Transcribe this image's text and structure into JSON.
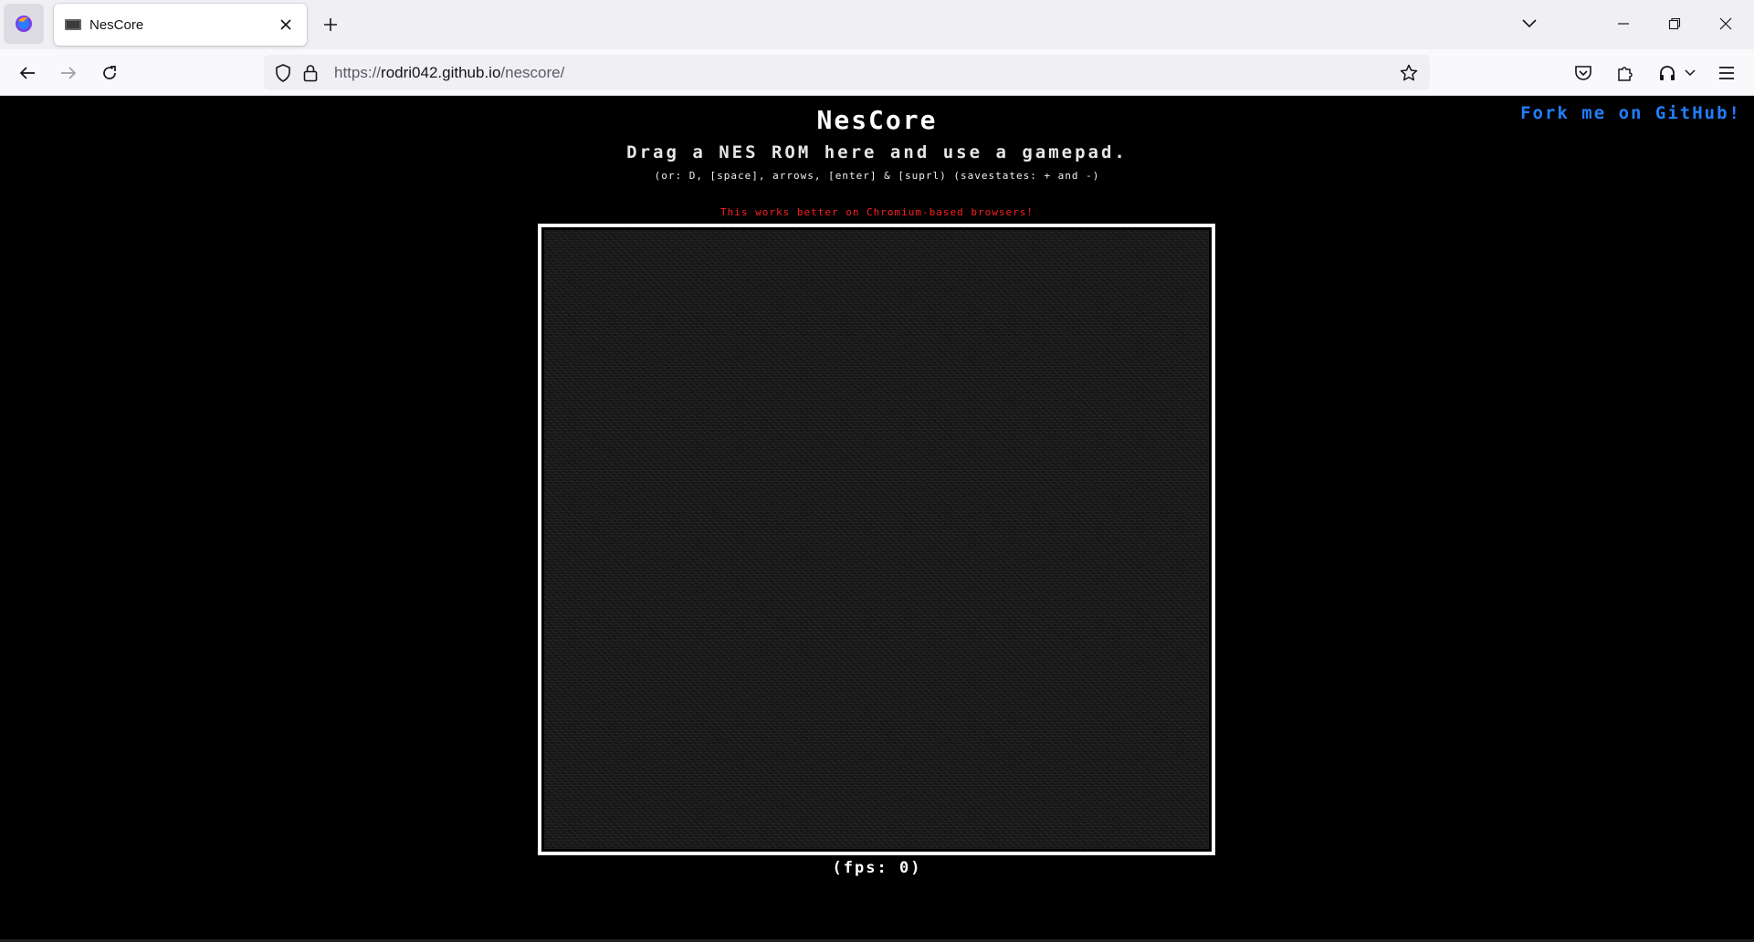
{
  "browser": {
    "tab": {
      "title": "NesCore"
    },
    "url": {
      "scheme": "https://",
      "host": "rodri042.github.io",
      "path": "/nescore/"
    }
  },
  "page": {
    "fork_link": "Fork me on GitHub!",
    "title": "NesCore",
    "subtitle": "Drag a NES ROM here and use a gamepad.",
    "hint": "(or: D, [space], arrows, [enter] & [suprl) (savestates: + and -)",
    "warning": "This works better on Chromium-based browsers!",
    "fps": "(fps: 0)"
  },
  "colors": {
    "fork_link": "#1f7fff",
    "warning": "#ff2020",
    "background": "#000000"
  }
}
